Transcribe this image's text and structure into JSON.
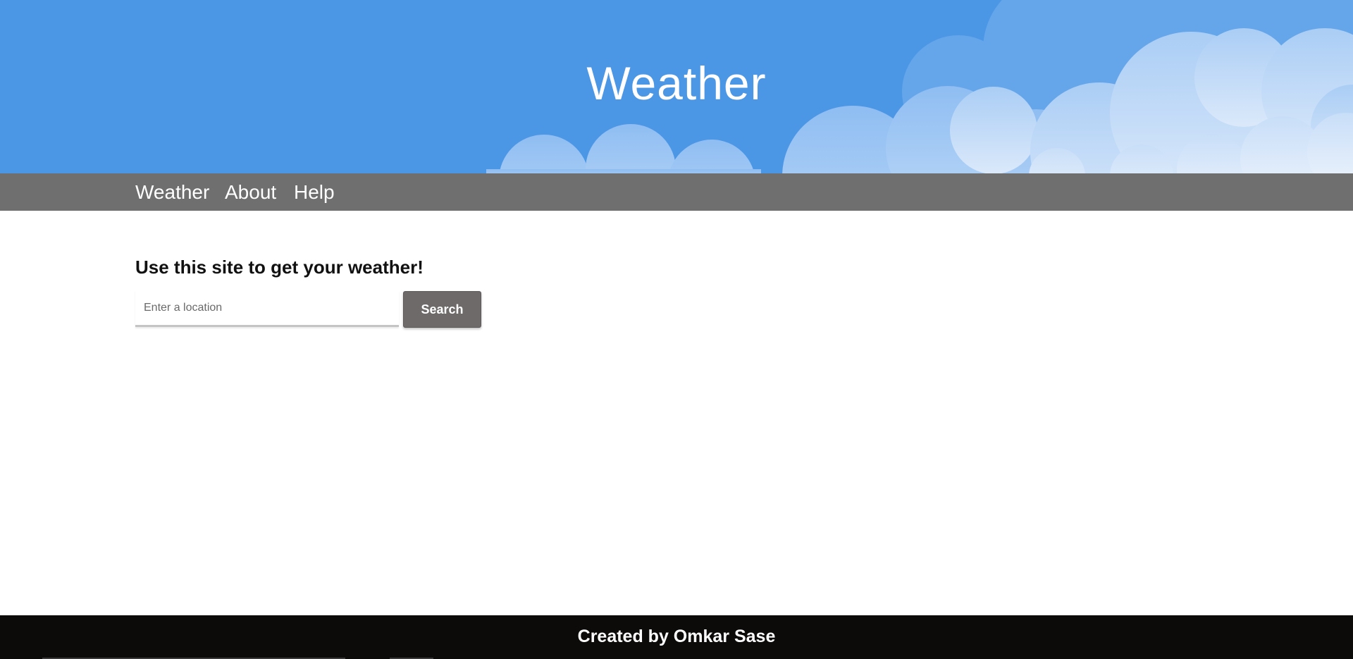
{
  "header": {
    "title": "Weather",
    "background_color": "#4b97e6"
  },
  "nav": {
    "background_color": "#6f6f6f",
    "items": [
      {
        "label": "Weather"
      },
      {
        "label": "About"
      },
      {
        "label": "Help"
      }
    ]
  },
  "main": {
    "heading": "Use this site to get your weather!",
    "search": {
      "placeholder": "Enter a location",
      "value": "",
      "button_label": "Search",
      "button_color": "#6e6a6a"
    }
  },
  "footer": {
    "text": "Created by Omkar Sase",
    "background_color": "#0d0b09"
  }
}
